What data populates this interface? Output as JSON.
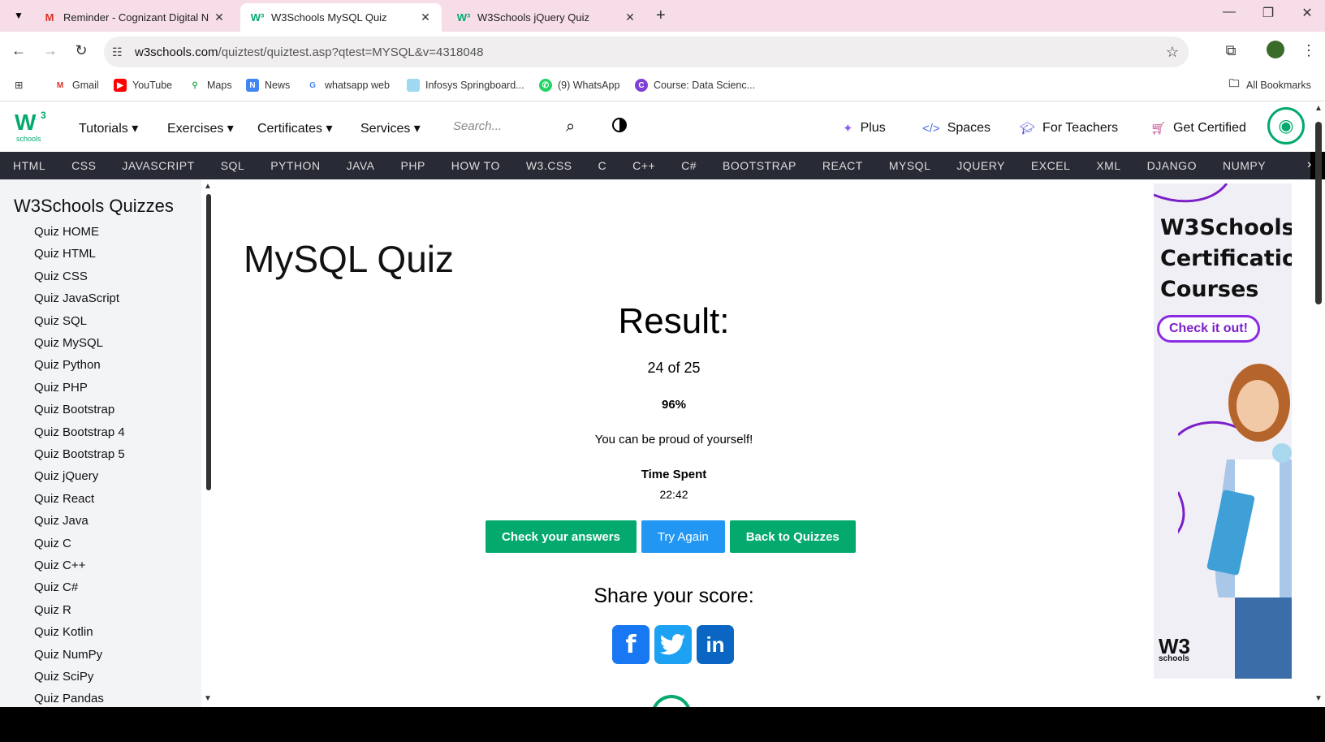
{
  "browser": {
    "tabs": [
      {
        "label": "Reminder - Cognizant Digital N",
        "icon": "gmail-icon",
        "active": false
      },
      {
        "label": "W3Schools MySQL Quiz",
        "icon": "w3schools-icon",
        "active": true
      },
      {
        "label": "W3Schools jQuery Quiz",
        "icon": "w3schools-icon",
        "active": false
      }
    ],
    "url_host": "w3schools.com",
    "url_path": "/quiztest/quiztest.asp?qtest=MYSQL&v=4318048",
    "bookmarks": [
      "Gmail",
      "YouTube",
      "Maps",
      "News",
      "whatsapp web",
      "Infosys Springboard...",
      "(9) WhatsApp",
      "Course: Data Scienc..."
    ],
    "all_bookmarks": "All Bookmarks"
  },
  "site": {
    "menu": [
      "Tutorials",
      "Exercises",
      "Certificates",
      "Services"
    ],
    "search_placeholder": "Search...",
    "right_links": [
      "Plus",
      "Spaces",
      "For Teachers",
      "Get Certified"
    ],
    "topnav": [
      "HTML",
      "CSS",
      "JAVASCRIPT",
      "SQL",
      "PYTHON",
      "JAVA",
      "PHP",
      "HOW TO",
      "W3.CSS",
      "C",
      "C++",
      "C#",
      "BOOTSTRAP",
      "REACT",
      "MYSQL",
      "JQUERY",
      "EXCEL",
      "XML",
      "DJANGO",
      "NUMPY"
    ],
    "accent": "#04aa6d",
    "nav_bg": "#282a35"
  },
  "sidebar": {
    "title": "W3Schools Quizzes",
    "items": [
      "Quiz HOME",
      "Quiz HTML",
      "Quiz CSS",
      "Quiz JavaScript",
      "Quiz SQL",
      "Quiz MySQL",
      "Quiz Python",
      "Quiz PHP",
      "Quiz Bootstrap",
      "Quiz Bootstrap 4",
      "Quiz Bootstrap 5",
      "Quiz jQuery",
      "Quiz React",
      "Quiz Java",
      "Quiz C",
      "Quiz C++",
      "Quiz C#",
      "Quiz R",
      "Quiz Kotlin",
      "Quiz NumPy",
      "Quiz SciPy",
      "Quiz Pandas"
    ]
  },
  "main": {
    "title": "MySQL Quiz",
    "result_heading": "Result:",
    "score": "24 of 25",
    "percent": "96%",
    "message": "You can be proud of yourself!",
    "time_label": "Time Spent",
    "time_value": "22:42",
    "buttons": {
      "check": "Check your answers",
      "retry": "Try Again",
      "back": "Back to Quizzes"
    },
    "share_heading": "Share your score:"
  },
  "ad": {
    "title_lines": [
      "W3Schools",
      "Certification",
      "Courses"
    ],
    "cta": "Check it out!",
    "brand": "W3",
    "brand_sub": "schools"
  }
}
